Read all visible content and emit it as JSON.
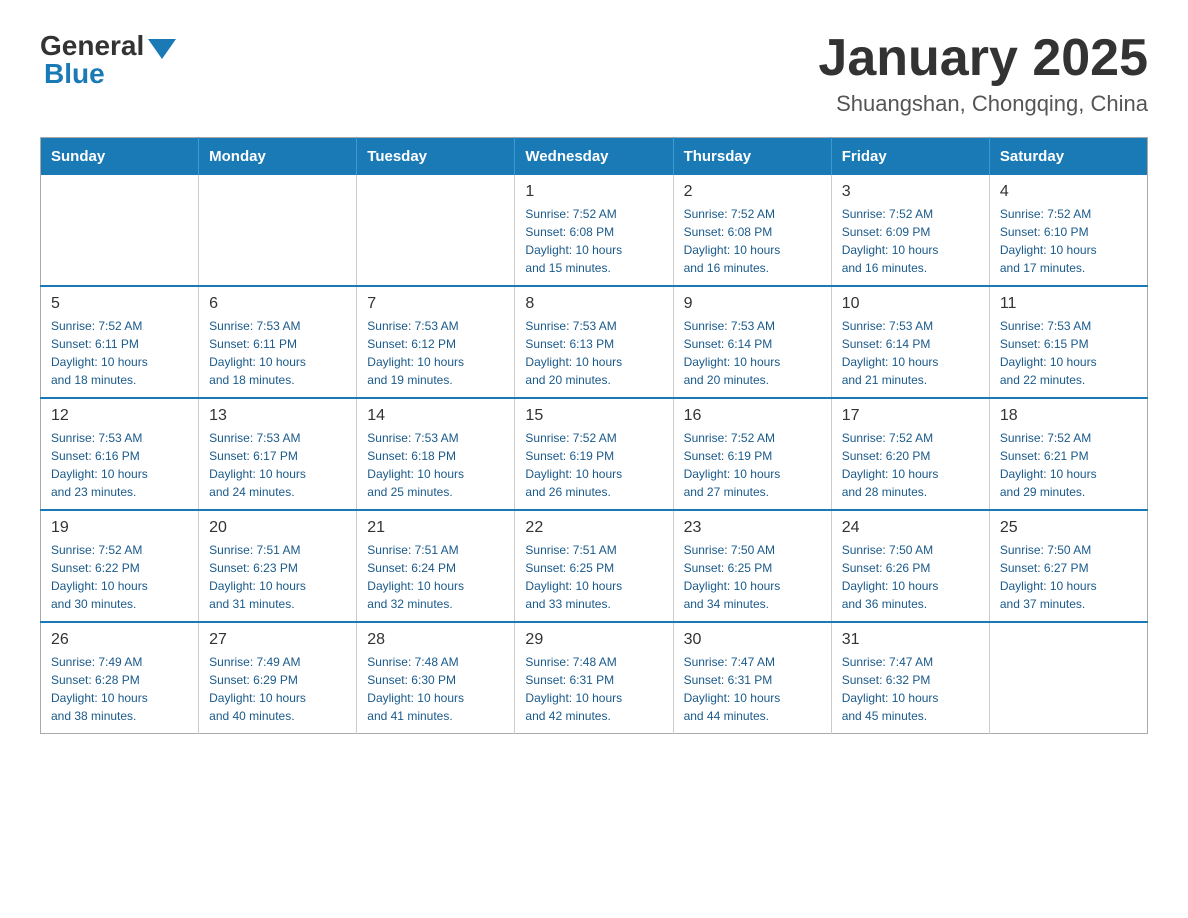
{
  "logo": {
    "general": "General",
    "blue": "Blue"
  },
  "title": "January 2025",
  "subtitle": "Shuangshan, Chongqing, China",
  "days_header": [
    "Sunday",
    "Monday",
    "Tuesday",
    "Wednesday",
    "Thursday",
    "Friday",
    "Saturday"
  ],
  "weeks": [
    [
      {
        "day": "",
        "info": ""
      },
      {
        "day": "",
        "info": ""
      },
      {
        "day": "",
        "info": ""
      },
      {
        "day": "1",
        "info": "Sunrise: 7:52 AM\nSunset: 6:08 PM\nDaylight: 10 hours\nand 15 minutes."
      },
      {
        "day": "2",
        "info": "Sunrise: 7:52 AM\nSunset: 6:08 PM\nDaylight: 10 hours\nand 16 minutes."
      },
      {
        "day": "3",
        "info": "Sunrise: 7:52 AM\nSunset: 6:09 PM\nDaylight: 10 hours\nand 16 minutes."
      },
      {
        "day": "4",
        "info": "Sunrise: 7:52 AM\nSunset: 6:10 PM\nDaylight: 10 hours\nand 17 minutes."
      }
    ],
    [
      {
        "day": "5",
        "info": "Sunrise: 7:52 AM\nSunset: 6:11 PM\nDaylight: 10 hours\nand 18 minutes."
      },
      {
        "day": "6",
        "info": "Sunrise: 7:53 AM\nSunset: 6:11 PM\nDaylight: 10 hours\nand 18 minutes."
      },
      {
        "day": "7",
        "info": "Sunrise: 7:53 AM\nSunset: 6:12 PM\nDaylight: 10 hours\nand 19 minutes."
      },
      {
        "day": "8",
        "info": "Sunrise: 7:53 AM\nSunset: 6:13 PM\nDaylight: 10 hours\nand 20 minutes."
      },
      {
        "day": "9",
        "info": "Sunrise: 7:53 AM\nSunset: 6:14 PM\nDaylight: 10 hours\nand 20 minutes."
      },
      {
        "day": "10",
        "info": "Sunrise: 7:53 AM\nSunset: 6:14 PM\nDaylight: 10 hours\nand 21 minutes."
      },
      {
        "day": "11",
        "info": "Sunrise: 7:53 AM\nSunset: 6:15 PM\nDaylight: 10 hours\nand 22 minutes."
      }
    ],
    [
      {
        "day": "12",
        "info": "Sunrise: 7:53 AM\nSunset: 6:16 PM\nDaylight: 10 hours\nand 23 minutes."
      },
      {
        "day": "13",
        "info": "Sunrise: 7:53 AM\nSunset: 6:17 PM\nDaylight: 10 hours\nand 24 minutes."
      },
      {
        "day": "14",
        "info": "Sunrise: 7:53 AM\nSunset: 6:18 PM\nDaylight: 10 hours\nand 25 minutes."
      },
      {
        "day": "15",
        "info": "Sunrise: 7:52 AM\nSunset: 6:19 PM\nDaylight: 10 hours\nand 26 minutes."
      },
      {
        "day": "16",
        "info": "Sunrise: 7:52 AM\nSunset: 6:19 PM\nDaylight: 10 hours\nand 27 minutes."
      },
      {
        "day": "17",
        "info": "Sunrise: 7:52 AM\nSunset: 6:20 PM\nDaylight: 10 hours\nand 28 minutes."
      },
      {
        "day": "18",
        "info": "Sunrise: 7:52 AM\nSunset: 6:21 PM\nDaylight: 10 hours\nand 29 minutes."
      }
    ],
    [
      {
        "day": "19",
        "info": "Sunrise: 7:52 AM\nSunset: 6:22 PM\nDaylight: 10 hours\nand 30 minutes."
      },
      {
        "day": "20",
        "info": "Sunrise: 7:51 AM\nSunset: 6:23 PM\nDaylight: 10 hours\nand 31 minutes."
      },
      {
        "day": "21",
        "info": "Sunrise: 7:51 AM\nSunset: 6:24 PM\nDaylight: 10 hours\nand 32 minutes."
      },
      {
        "day": "22",
        "info": "Sunrise: 7:51 AM\nSunset: 6:25 PM\nDaylight: 10 hours\nand 33 minutes."
      },
      {
        "day": "23",
        "info": "Sunrise: 7:50 AM\nSunset: 6:25 PM\nDaylight: 10 hours\nand 34 minutes."
      },
      {
        "day": "24",
        "info": "Sunrise: 7:50 AM\nSunset: 6:26 PM\nDaylight: 10 hours\nand 36 minutes."
      },
      {
        "day": "25",
        "info": "Sunrise: 7:50 AM\nSunset: 6:27 PM\nDaylight: 10 hours\nand 37 minutes."
      }
    ],
    [
      {
        "day": "26",
        "info": "Sunrise: 7:49 AM\nSunset: 6:28 PM\nDaylight: 10 hours\nand 38 minutes."
      },
      {
        "day": "27",
        "info": "Sunrise: 7:49 AM\nSunset: 6:29 PM\nDaylight: 10 hours\nand 40 minutes."
      },
      {
        "day": "28",
        "info": "Sunrise: 7:48 AM\nSunset: 6:30 PM\nDaylight: 10 hours\nand 41 minutes."
      },
      {
        "day": "29",
        "info": "Sunrise: 7:48 AM\nSunset: 6:31 PM\nDaylight: 10 hours\nand 42 minutes."
      },
      {
        "day": "30",
        "info": "Sunrise: 7:47 AM\nSunset: 6:31 PM\nDaylight: 10 hours\nand 44 minutes."
      },
      {
        "day": "31",
        "info": "Sunrise: 7:47 AM\nSunset: 6:32 PM\nDaylight: 10 hours\nand 45 minutes."
      },
      {
        "day": "",
        "info": ""
      }
    ]
  ]
}
